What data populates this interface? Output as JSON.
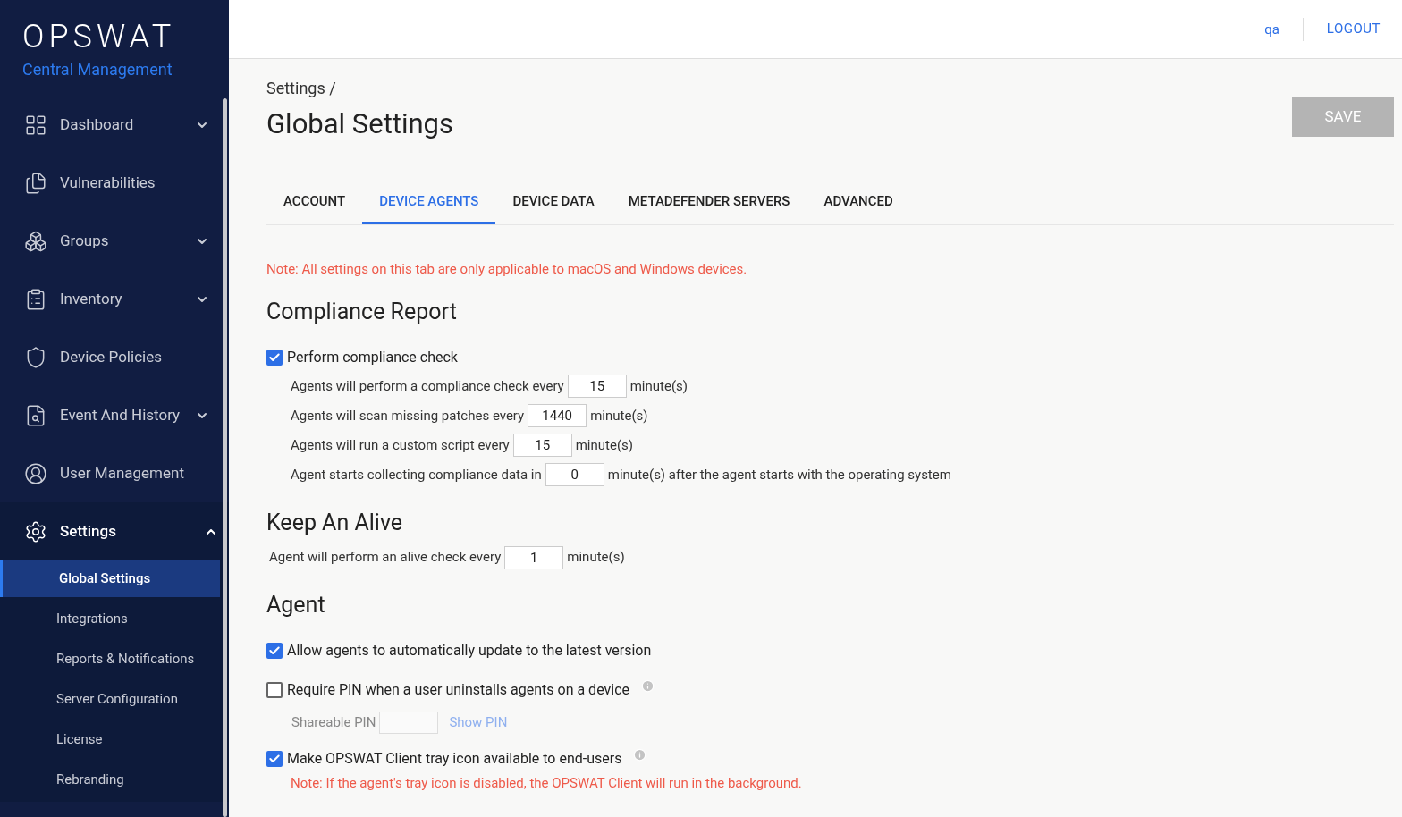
{
  "brand": {
    "logo": "OPSWAT",
    "product": "Central Management"
  },
  "sidebar": {
    "items": [
      {
        "label": "Dashboard",
        "expandable": true,
        "expanded": false
      },
      {
        "label": "Vulnerabilities",
        "expandable": false,
        "expanded": false
      },
      {
        "label": "Groups",
        "expandable": true,
        "expanded": false
      },
      {
        "label": "Inventory",
        "expandable": true,
        "expanded": false
      },
      {
        "label": "Device Policies",
        "expandable": false,
        "expanded": false
      },
      {
        "label": "Event And History",
        "expandable": true,
        "expanded": false
      },
      {
        "label": "User Management",
        "expandable": false,
        "expanded": false
      },
      {
        "label": "Settings",
        "expandable": true,
        "expanded": true,
        "children": [
          {
            "label": "Global Settings",
            "selected": true
          },
          {
            "label": "Integrations",
            "selected": false
          },
          {
            "label": "Reports & Notifications",
            "selected": false
          },
          {
            "label": "Server Configuration",
            "selected": false
          },
          {
            "label": "License",
            "selected": false
          },
          {
            "label": "Rebranding",
            "selected": false
          }
        ]
      }
    ]
  },
  "header": {
    "user": "qa",
    "logout": "LOGOUT"
  },
  "breadcrumb": "Settings /",
  "title": "Global Settings",
  "save_button": {
    "label": "SAVE",
    "disabled": true
  },
  "tabs": [
    {
      "label": "ACCOUNT",
      "selected": false
    },
    {
      "label": "DEVICE AGENTS",
      "selected": true
    },
    {
      "label": "DEVICE DATA",
      "selected": false
    },
    {
      "label": "METADEFENDER SERVERS",
      "selected": false
    },
    {
      "label": "ADVANCED",
      "selected": false
    }
  ],
  "note": "Note: All settings on this tab are only applicable to macOS and Windows devices.",
  "sections": [
    {
      "title": "Compliance Report",
      "items": [
        {
          "kind": "checkbox",
          "label": "Perform compliance check",
          "checked": true,
          "info": false
        },
        {
          "kind": "interval",
          "prefix": "Agents will perform a compliance check every",
          "value": "15",
          "suffix": "minute(s)",
          "indent": true
        },
        {
          "kind": "interval",
          "prefix": "Agents will scan missing patches every",
          "value": "1440",
          "suffix": "minute(s)",
          "indent": true
        },
        {
          "kind": "interval",
          "prefix": "Agents will run a custom script every",
          "value": "15",
          "suffix": "minute(s)",
          "indent": true
        },
        {
          "kind": "interval",
          "prefix": "Agent starts collecting compliance data in",
          "value": "0",
          "suffix": "minute(s) after the agent starts with the operating system",
          "indent": true
        }
      ]
    },
    {
      "title": "Keep An Alive",
      "items": [
        {
          "kind": "interval",
          "prefix": "Agent will perform an alive check every",
          "value": "1",
          "suffix": "minute(s)",
          "indent": false
        }
      ]
    },
    {
      "title": "Agent",
      "items": [
        {
          "kind": "checkbox",
          "label": "Allow agents to automatically update to the latest version",
          "checked": true,
          "info": false
        },
        {
          "kind": "checkbox",
          "label": "Require PIN when a user uninstalls agents on a device",
          "checked": false,
          "info": true
        },
        {
          "kind": "pin",
          "label": "Shareable PIN",
          "link": "Show PIN",
          "disabled": true
        },
        {
          "kind": "checkbox",
          "label": "Make OPSWAT Client tray icon available to end-users",
          "checked": true,
          "info": true
        },
        {
          "kind": "note",
          "text": "Note: If the agent's tray icon is disabled, the OPSWAT Client will run in the background."
        }
      ]
    }
  ]
}
